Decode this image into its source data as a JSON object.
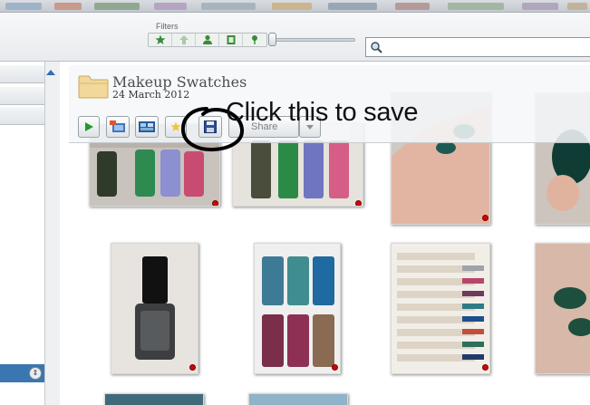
{
  "filters": {
    "label": "Filters",
    "buttons": [
      "star-icon",
      "arrow-up-icon",
      "person-icon",
      "film-icon",
      "map-pin-icon"
    ]
  },
  "search": {
    "value": "",
    "placeholder": ""
  },
  "album": {
    "title": "Makeup Swatches",
    "date": "24 March 2012"
  },
  "toolbar": {
    "share_label": "Share"
  },
  "annotation": {
    "text": "Click this to save"
  },
  "colors": {
    "accent": "#3a76b0",
    "pin": "#d40000",
    "annotation_ink": "#000000"
  }
}
